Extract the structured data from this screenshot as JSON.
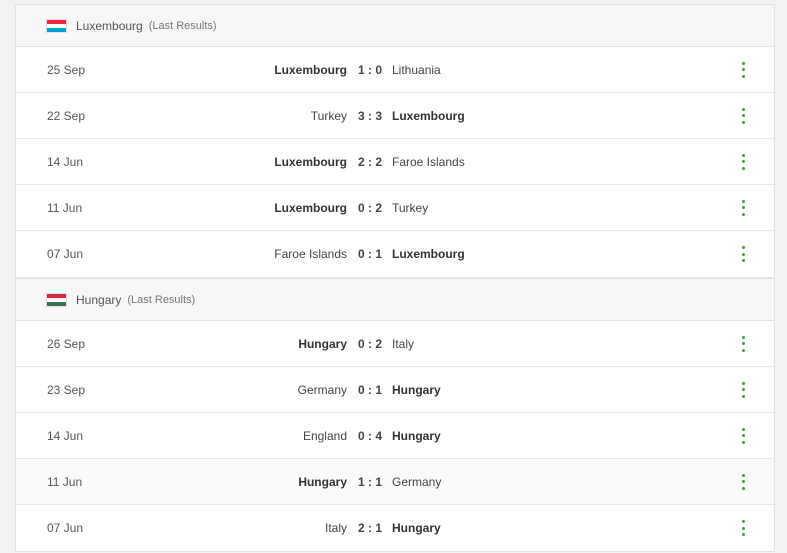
{
  "colors": {
    "accent": "#3da33d",
    "header_bg": "#f7f7f7",
    "border": "#e4e4e4"
  },
  "groups": [
    {
      "team": "Luxembourg",
      "note": "(Last Results)",
      "flag_colors": [
        "#ed2939",
        "#ffffff",
        "#00a1de"
      ],
      "matches": [
        {
          "date": "25 Sep",
          "home": "Luxembourg",
          "score": "1 : 0",
          "away": "Lithuania",
          "bold": "home"
        },
        {
          "date": "22 Sep",
          "home": "Turkey",
          "score": "3 : 3",
          "away": "Luxembourg",
          "bold": "away"
        },
        {
          "date": "14 Jun",
          "home": "Luxembourg",
          "score": "2 : 2",
          "away": "Faroe Islands",
          "bold": "home"
        },
        {
          "date": "11 Jun",
          "home": "Luxembourg",
          "score": "0 : 2",
          "away": "Turkey",
          "bold": "home"
        },
        {
          "date": "07 Jun",
          "home": "Faroe Islands",
          "score": "0 : 1",
          "away": "Luxembourg",
          "bold": "away"
        }
      ]
    },
    {
      "team": "Hungary",
      "note": "(Last Results)",
      "flag_colors": [
        "#cd2a3e",
        "#ffffff",
        "#436f4d"
      ],
      "matches": [
        {
          "date": "26 Sep",
          "home": "Hungary",
          "score": "0 : 2",
          "away": "Italy",
          "bold": "home"
        },
        {
          "date": "23 Sep",
          "home": "Germany",
          "score": "0 : 1",
          "away": "Hungary",
          "bold": "away"
        },
        {
          "date": "14 Jun",
          "home": "England",
          "score": "0 : 4",
          "away": "Hungary",
          "bold": "away"
        },
        {
          "date": "11 Jun",
          "home": "Hungary",
          "score": "1 : 1",
          "away": "Germany",
          "bold": "home"
        },
        {
          "date": "07 Jun",
          "home": "Italy",
          "score": "2 : 1",
          "away": "Hungary",
          "bold": "away"
        }
      ]
    }
  ]
}
